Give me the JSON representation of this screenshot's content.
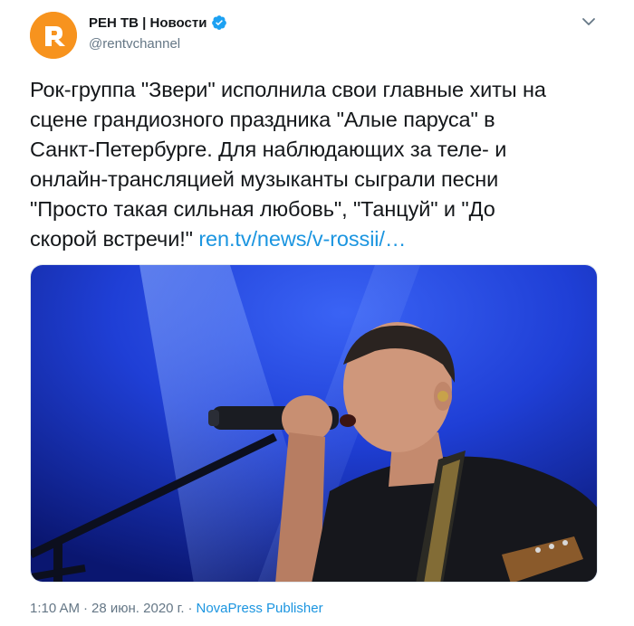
{
  "header": {
    "display_name": "РЕН ТВ | Новости",
    "handle": "@rentvchannel",
    "verified_icon": "verified-badge-icon",
    "menu_icon": "chevron-down-icon"
  },
  "tweet": {
    "text": "Рок-группа \"Звери\" исполнила свои главные хиты на\nсцене грандиозного праздника \"Алые паруса\" в\nСанкт-Петербурге. Для наблюдающих за теле- и\nонлайн-трансляцией музыканты сыграли песни\n\"Просто такая сильная любовь\", \"Танцуй\" и \"До\nскорой встречи!\" ",
    "link": "ren.tv/news/v-rossii/…"
  },
  "footer": {
    "time": "1:10 AM",
    "separator": "·",
    "date": "28 июн. 2020 г.",
    "source": "NovaPress Publisher"
  },
  "colors": {
    "accent": "#1b95e0",
    "brand": "#f7931e",
    "muted": "#657786"
  }
}
